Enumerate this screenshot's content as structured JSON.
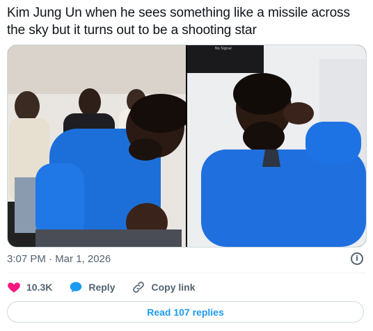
{
  "tweet": {
    "text": "Kim Jung Un when he sees something like a missile across the sky but it turns out to be a shooting star",
    "timestamp": "3:07 PM · Mar 1, 2026"
  },
  "media": {
    "left_alt": "Man in blue shirt clenching fist in excitement",
    "right_alt": "Man in blue shirt holding fist to mouth",
    "tv_text": "No Signal"
  },
  "actions": {
    "like_count": "10.3K",
    "reply_label": "Reply",
    "copy_link_label": "Copy link"
  },
  "replies": {
    "read_label": "Read 107 replies"
  },
  "colors": {
    "like": "#f91880",
    "reply": "#1d9bf0",
    "accent": "#1d9bf0",
    "muted": "#536471"
  },
  "icons": {
    "like": "heart-icon",
    "reply": "speech-bubble-icon",
    "copy": "link-icon",
    "info": "info-icon"
  }
}
